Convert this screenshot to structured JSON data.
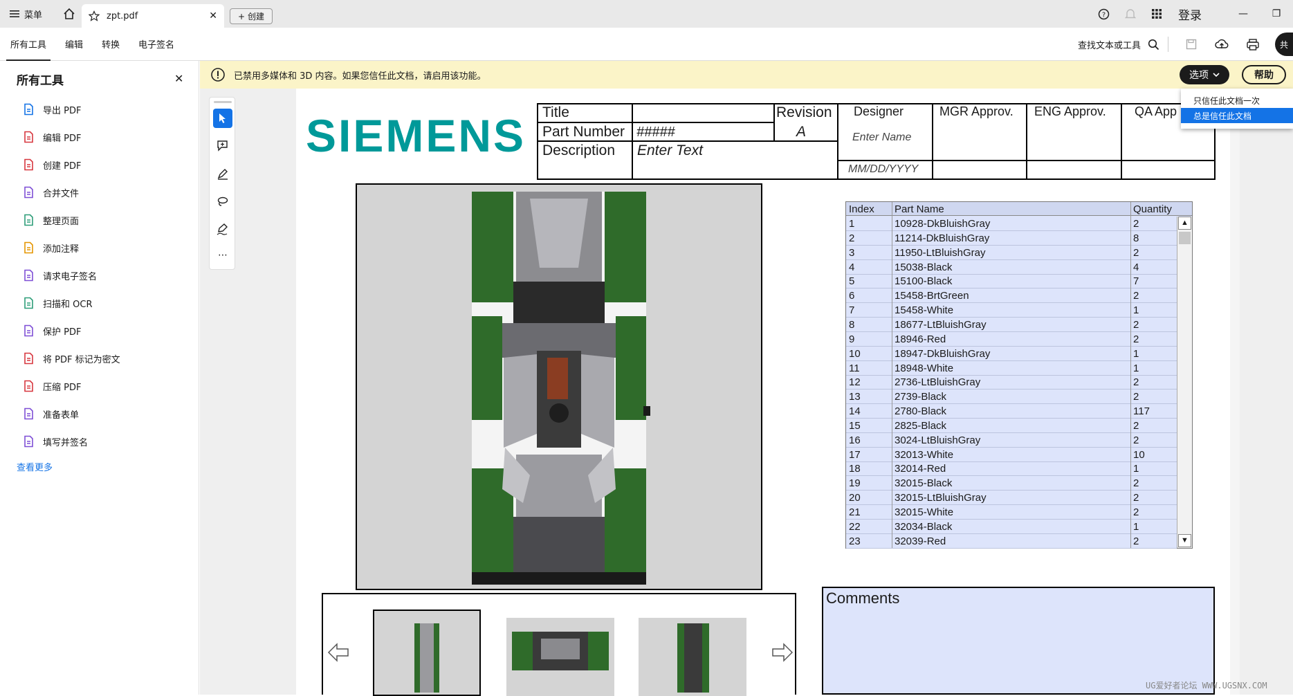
{
  "tabbar": {
    "menu_label": "菜单",
    "doc_tab": "zpt.pdf",
    "create_label": "创建",
    "login": "登录"
  },
  "toolbar": {
    "tabs": [
      "所有工具",
      "编辑",
      "转换",
      "电子签名"
    ],
    "find_label": "查找文本或工具"
  },
  "sidebar": {
    "title": "所有工具",
    "items": [
      {
        "label": "导出 PDF",
        "icon": "export-pdf-icon",
        "color": "#1473e6"
      },
      {
        "label": "编辑 PDF",
        "icon": "edit-pdf-icon",
        "color": "#d7373f"
      },
      {
        "label": "创建 PDF",
        "icon": "create-pdf-icon",
        "color": "#d7373f"
      },
      {
        "label": "合并文件",
        "icon": "combine-files-icon",
        "color": "#7e4fd6"
      },
      {
        "label": "整理页面",
        "icon": "organize-pages-icon",
        "color": "#2d9d78"
      },
      {
        "label": "添加注释",
        "icon": "comment-icon",
        "color": "#e59500"
      },
      {
        "label": "请求电子签名",
        "icon": "request-esign-icon",
        "color": "#7e4fd6"
      },
      {
        "label": "扫描和 OCR",
        "icon": "scan-ocr-icon",
        "color": "#2d9d78"
      },
      {
        "label": "保护 PDF",
        "icon": "protect-pdf-icon",
        "color": "#7e4fd6"
      },
      {
        "label": "将 PDF 标记为密文",
        "icon": "redact-icon",
        "color": "#d7373f"
      },
      {
        "label": "压缩 PDF",
        "icon": "compress-pdf-icon",
        "color": "#d7373f"
      },
      {
        "label": "准备表单",
        "icon": "prepare-form-icon",
        "color": "#7e4fd6"
      },
      {
        "label": "填写并签名",
        "icon": "fill-sign-icon",
        "color": "#7e4fd6"
      }
    ],
    "more": "查看更多"
  },
  "notice": {
    "text": "已禁用多媒体和 3D 内容。如果您信任此文档，请启用该功能。",
    "options": "选项",
    "help": "帮助"
  },
  "dropdown": {
    "items": [
      "只信任此文档一次",
      "总是信任此文档"
    ],
    "selected": 1
  },
  "titleblock": {
    "logo": "SIEMENS",
    "title_label": "Title",
    "part_number_label": "Part Number",
    "part_number": "#####",
    "description_label": "Description",
    "description": "Enter Text",
    "revision_label": "Revision",
    "revision": "A",
    "designer_label": "Designer",
    "designer": "Enter Name",
    "date": "MM/DD/YYYY",
    "mgr": "MGR Approv.",
    "eng": "ENG Approv.",
    "qa": "QA App"
  },
  "parts_table": {
    "headers": [
      "Index",
      "Part Name",
      "Quantity"
    ],
    "rows": [
      [
        "1",
        "10928-DkBluishGray",
        "2"
      ],
      [
        "2",
        "11214-DkBluishGray",
        "8"
      ],
      [
        "3",
        "11950-LtBluishGray",
        "2"
      ],
      [
        "4",
        "15038-Black",
        "4"
      ],
      [
        "5",
        "15100-Black",
        "7"
      ],
      [
        "6",
        "15458-BrtGreen",
        "2"
      ],
      [
        "7",
        "15458-White",
        "1"
      ],
      [
        "8",
        "18677-LtBluishGray",
        "2"
      ],
      [
        "9",
        "18946-Red",
        "2"
      ],
      [
        "10",
        "18947-DkBluishGray",
        "1"
      ],
      [
        "11",
        "18948-White",
        "1"
      ],
      [
        "12",
        "2736-LtBluishGray",
        "2"
      ],
      [
        "13",
        "2739-Black",
        "2"
      ],
      [
        "14",
        "2780-Black",
        "117"
      ],
      [
        "15",
        "2825-Black",
        "2"
      ],
      [
        "16",
        "3024-LtBluishGray",
        "2"
      ],
      [
        "17",
        "32013-White",
        "10"
      ],
      [
        "18",
        "32014-Red",
        "1"
      ],
      [
        "19",
        "32015-Black",
        "2"
      ],
      [
        "20",
        "32015-LtBluishGray",
        "2"
      ],
      [
        "21",
        "32015-White",
        "2"
      ],
      [
        "22",
        "32034-Black",
        "1"
      ],
      [
        "23",
        "32039-Red",
        "2"
      ]
    ]
  },
  "comments_label": "Comments",
  "watermark": "UG爱好者论坛 WWW.UGSNX.COM"
}
